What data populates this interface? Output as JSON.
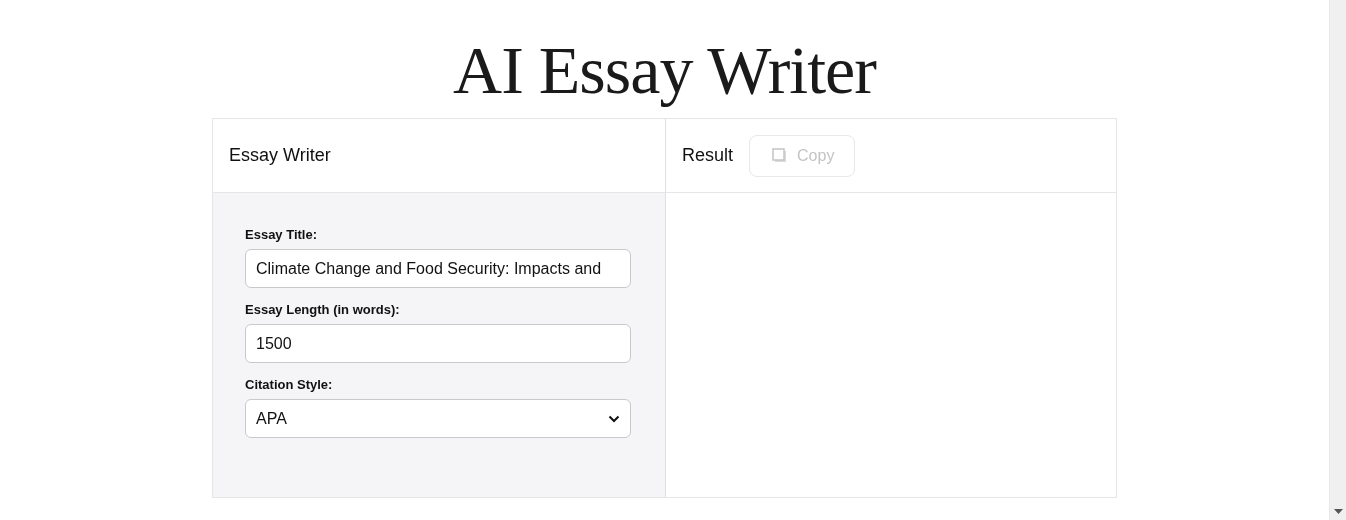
{
  "page_title": "AI Essay Writer",
  "writer_panel": {
    "title": "Essay Writer",
    "fields": [
      {
        "kind": "text",
        "label": "Essay Title:",
        "value": "Climate Change and Food Security: Impacts and"
      },
      {
        "kind": "text",
        "label": "Essay Length (in words):",
        "value": "1500"
      },
      {
        "kind": "select",
        "label": "Citation Style:",
        "value": "APA"
      }
    ]
  },
  "result_panel": {
    "title": "Result",
    "copy_button": {
      "label": "Copy",
      "disabled": true
    }
  }
}
